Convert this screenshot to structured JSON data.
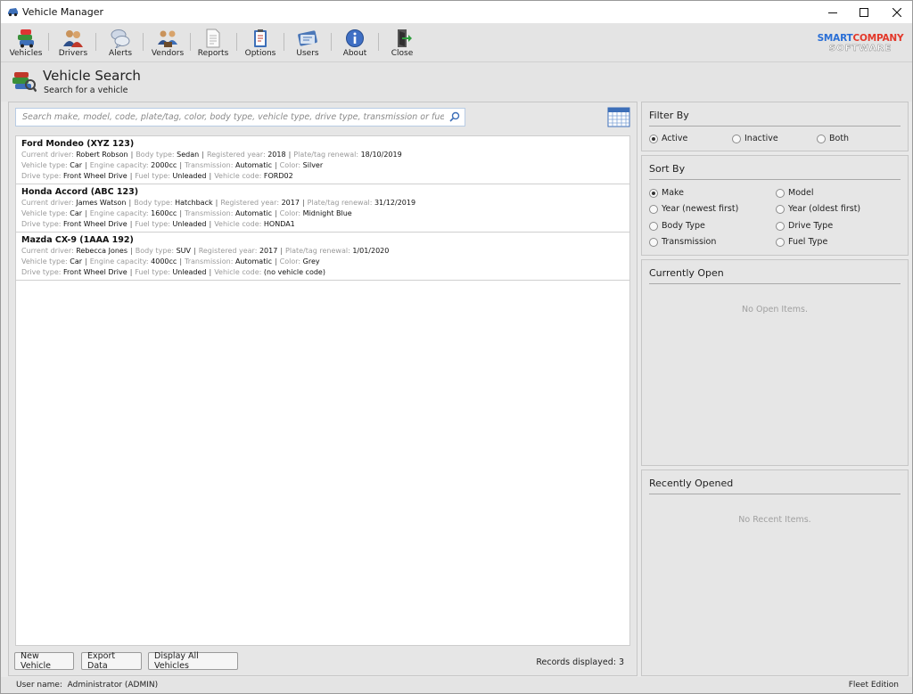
{
  "window": {
    "title": "Vehicle Manager"
  },
  "toolbar": {
    "items": [
      {
        "label": "Vehicles",
        "icon": "car-stack-icon"
      },
      {
        "label": "Drivers",
        "icon": "people-icon"
      },
      {
        "label": "Alerts",
        "icon": "speech-bubble-icon"
      },
      {
        "label": "Vendors",
        "icon": "vendors-icon"
      },
      {
        "label": "Reports",
        "icon": "document-icon"
      },
      {
        "label": "Options",
        "icon": "clipboard-icon"
      },
      {
        "label": "Users",
        "icon": "user-card-icon"
      },
      {
        "label": "About",
        "icon": "info-icon"
      },
      {
        "label": "Close",
        "icon": "exit-door-icon"
      }
    ]
  },
  "logo": {
    "line1a": "SMART",
    "line1b": "COMPANY",
    "line2": "SOFTWARE"
  },
  "header": {
    "title": "Vehicle Search",
    "subtitle": "Search for a vehicle"
  },
  "search": {
    "placeholder": "Search make, model, code, plate/tag, color, body type, vehicle type, drive type, transmission or fuel type"
  },
  "results": [
    {
      "title": "Ford Mondeo (XYZ 123)",
      "current_driver": "Robert Robson",
      "body_type": "Sedan",
      "registered_year": "2018",
      "plate_renewal": "18/10/2019",
      "vehicle_type": "Car",
      "engine_capacity": "2000cc",
      "transmission": "Automatic",
      "color": "Silver",
      "drive_type": "Front Wheel Drive",
      "fuel_type": "Unleaded",
      "vehicle_code": "FORD02"
    },
    {
      "title": "Honda Accord (ABC 123)",
      "current_driver": "James Watson",
      "body_type": "Hatchback",
      "registered_year": "2017",
      "plate_renewal": "31/12/2019",
      "vehicle_type": "Car",
      "engine_capacity": "1600cc",
      "transmission": "Automatic",
      "color": "Midnight Blue",
      "drive_type": "Front Wheel Drive",
      "fuel_type": "Unleaded",
      "vehicle_code": "HONDA1"
    },
    {
      "title": "Mazda CX-9 (1AAA 192)",
      "current_driver": "Rebecca Jones",
      "body_type": "SUV",
      "registered_year": "2017",
      "plate_renewal": "1/01/2020",
      "vehicle_type": "Car",
      "engine_capacity": "4000cc",
      "transmission": "Automatic",
      "color": "Grey",
      "drive_type": "Front Wheel Drive",
      "fuel_type": "Unleaded",
      "vehicle_code": "(no vehicle code)"
    }
  ],
  "field_labels": {
    "current_driver": "Current driver:",
    "body_type": "Body type:",
    "registered_year": "Registered year:",
    "plate_renewal": "Plate/tag renewal:",
    "vehicle_type": "Vehicle type:",
    "engine_capacity": "Engine capacity:",
    "transmission": "Transmission:",
    "color": "Color:",
    "drive_type": "Drive type:",
    "fuel_type": "Fuel type:",
    "vehicle_code": "Vehicle code:"
  },
  "buttons": {
    "new_vehicle": "New Vehicle",
    "export_data": "Export Data",
    "display_all": "Display All Vehicles"
  },
  "records": "Records displayed: 3",
  "filter": {
    "title": "Filter By",
    "options": [
      {
        "label": "Active",
        "selected": true
      },
      {
        "label": "Inactive",
        "selected": false
      },
      {
        "label": "Both",
        "selected": false
      }
    ]
  },
  "sort": {
    "title": "Sort By",
    "options": [
      {
        "label": "Make",
        "selected": true
      },
      {
        "label": "Model",
        "selected": false
      },
      {
        "label": "Year (newest first)",
        "selected": false
      },
      {
        "label": "Year (oldest first)",
        "selected": false
      },
      {
        "label": "Body Type",
        "selected": false
      },
      {
        "label": "Drive Type",
        "selected": false
      },
      {
        "label": "Transmission",
        "selected": false
      },
      {
        "label": "Fuel Type",
        "selected": false
      }
    ]
  },
  "currently_open": {
    "title": "Currently Open",
    "empty": "No Open Items."
  },
  "recently_opened": {
    "title": "Recently Opened",
    "empty": "No Recent Items."
  },
  "statusbar": {
    "user_label": "User name:",
    "user_value": "Administrator (ADMIN)",
    "edition": "Fleet Edition"
  }
}
